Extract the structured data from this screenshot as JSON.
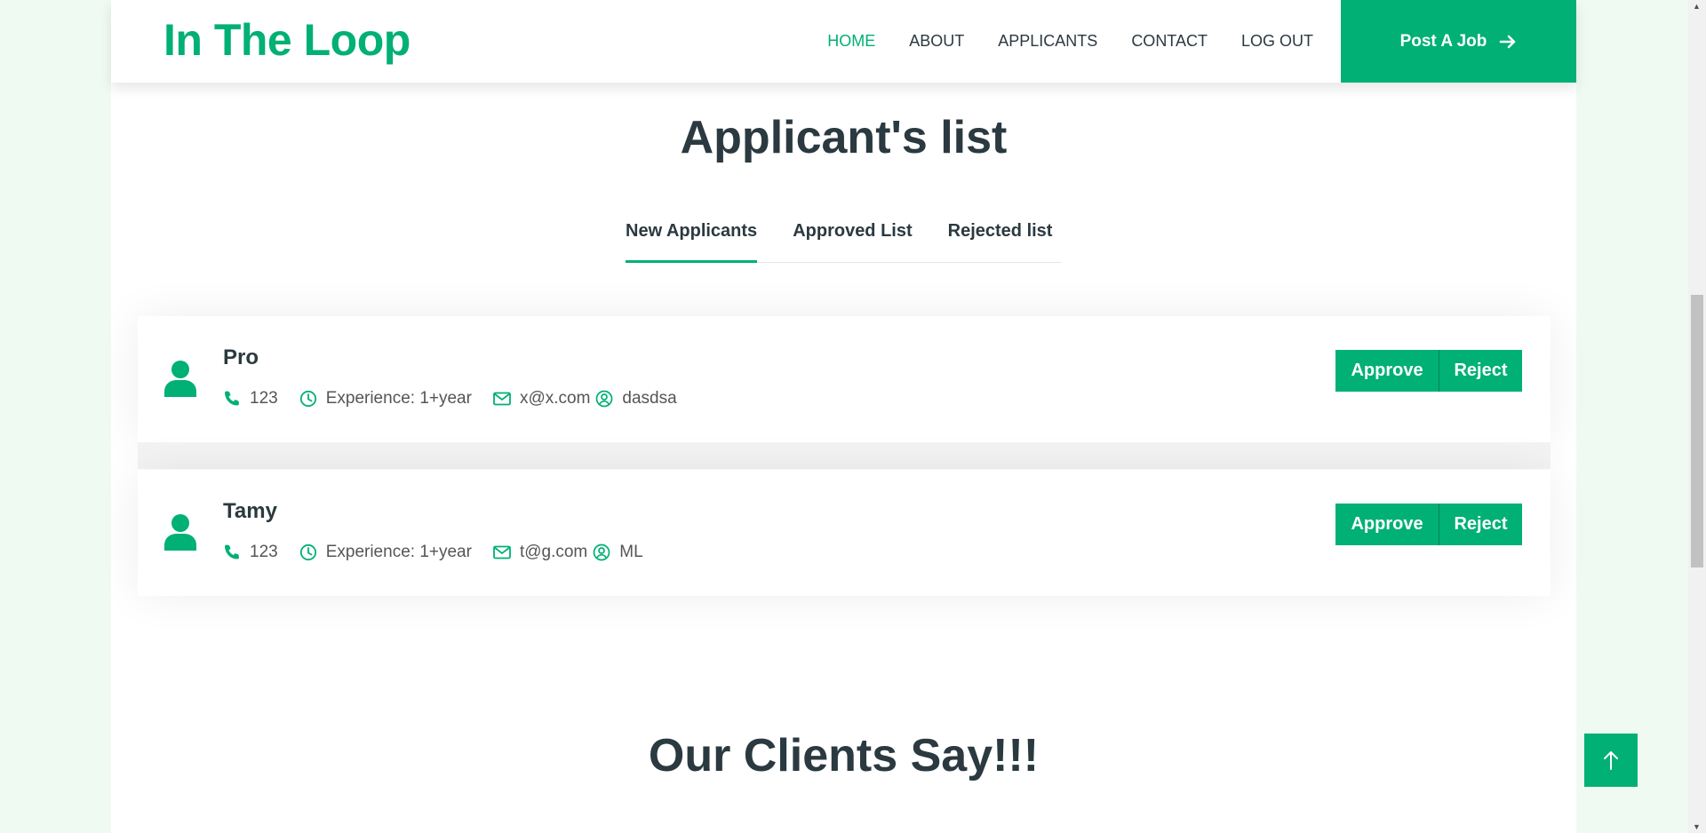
{
  "navbar": {
    "brand": "In The Loop",
    "links": [
      "HOME",
      "ABOUT",
      "APPLICANTS",
      "CONTACT",
      "LOG OUT"
    ],
    "post_job": "Post A Job"
  },
  "page_title": "Applicant's list",
  "tabs": [
    "New Applicants",
    "Approved List",
    "Rejected list"
  ],
  "applicants": [
    {
      "name": "Pro",
      "phone": "123",
      "experience": "Experience: 1+year",
      "email": "x@x.com",
      "skill": "dasdsa"
    },
    {
      "name": "Tamy",
      "phone": "123",
      "experience": "Experience: 1+year",
      "email": "t@g.com",
      "skill": "ML"
    }
  ],
  "buttons": {
    "approve": "Approve",
    "reject": "Reject"
  },
  "clients_title": "Our Clients Say!!!",
  "colors": {
    "accent": "#00b074",
    "text": "#2b3940",
    "page_bg": "#effbf2"
  },
  "icons": [
    "user-icon",
    "phone-icon",
    "clock-icon",
    "envelope-icon",
    "user-circle-icon",
    "arrow-right-icon",
    "arrow-up-icon"
  ]
}
